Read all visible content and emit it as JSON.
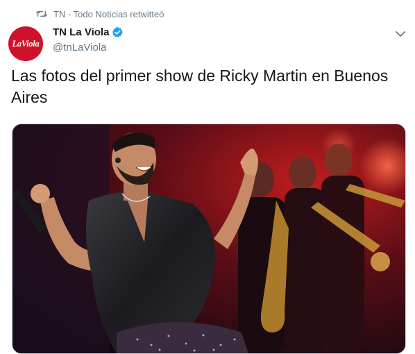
{
  "retweet": {
    "icon": "retweet-icon",
    "text": "TN - Todo Noticias retwitteó"
  },
  "author": {
    "avatar_text": "LaViola",
    "avatar_color": "#d0112b",
    "display_name": "TN La Viola",
    "verified_icon": "verified-badge-icon",
    "verified_color": "#1da1f2",
    "handle": "@tnLaViola"
  },
  "menu_icon": "chevron-down-icon",
  "tweet": {
    "text": "Las fotos del primer show de Ricky Martin en Buenos Aires"
  },
  "media": {
    "icon": "photo-image"
  },
  "colors": {
    "secondary_text": "#657786",
    "primary_text": "#14171a",
    "border": "#ccd6dd"
  }
}
